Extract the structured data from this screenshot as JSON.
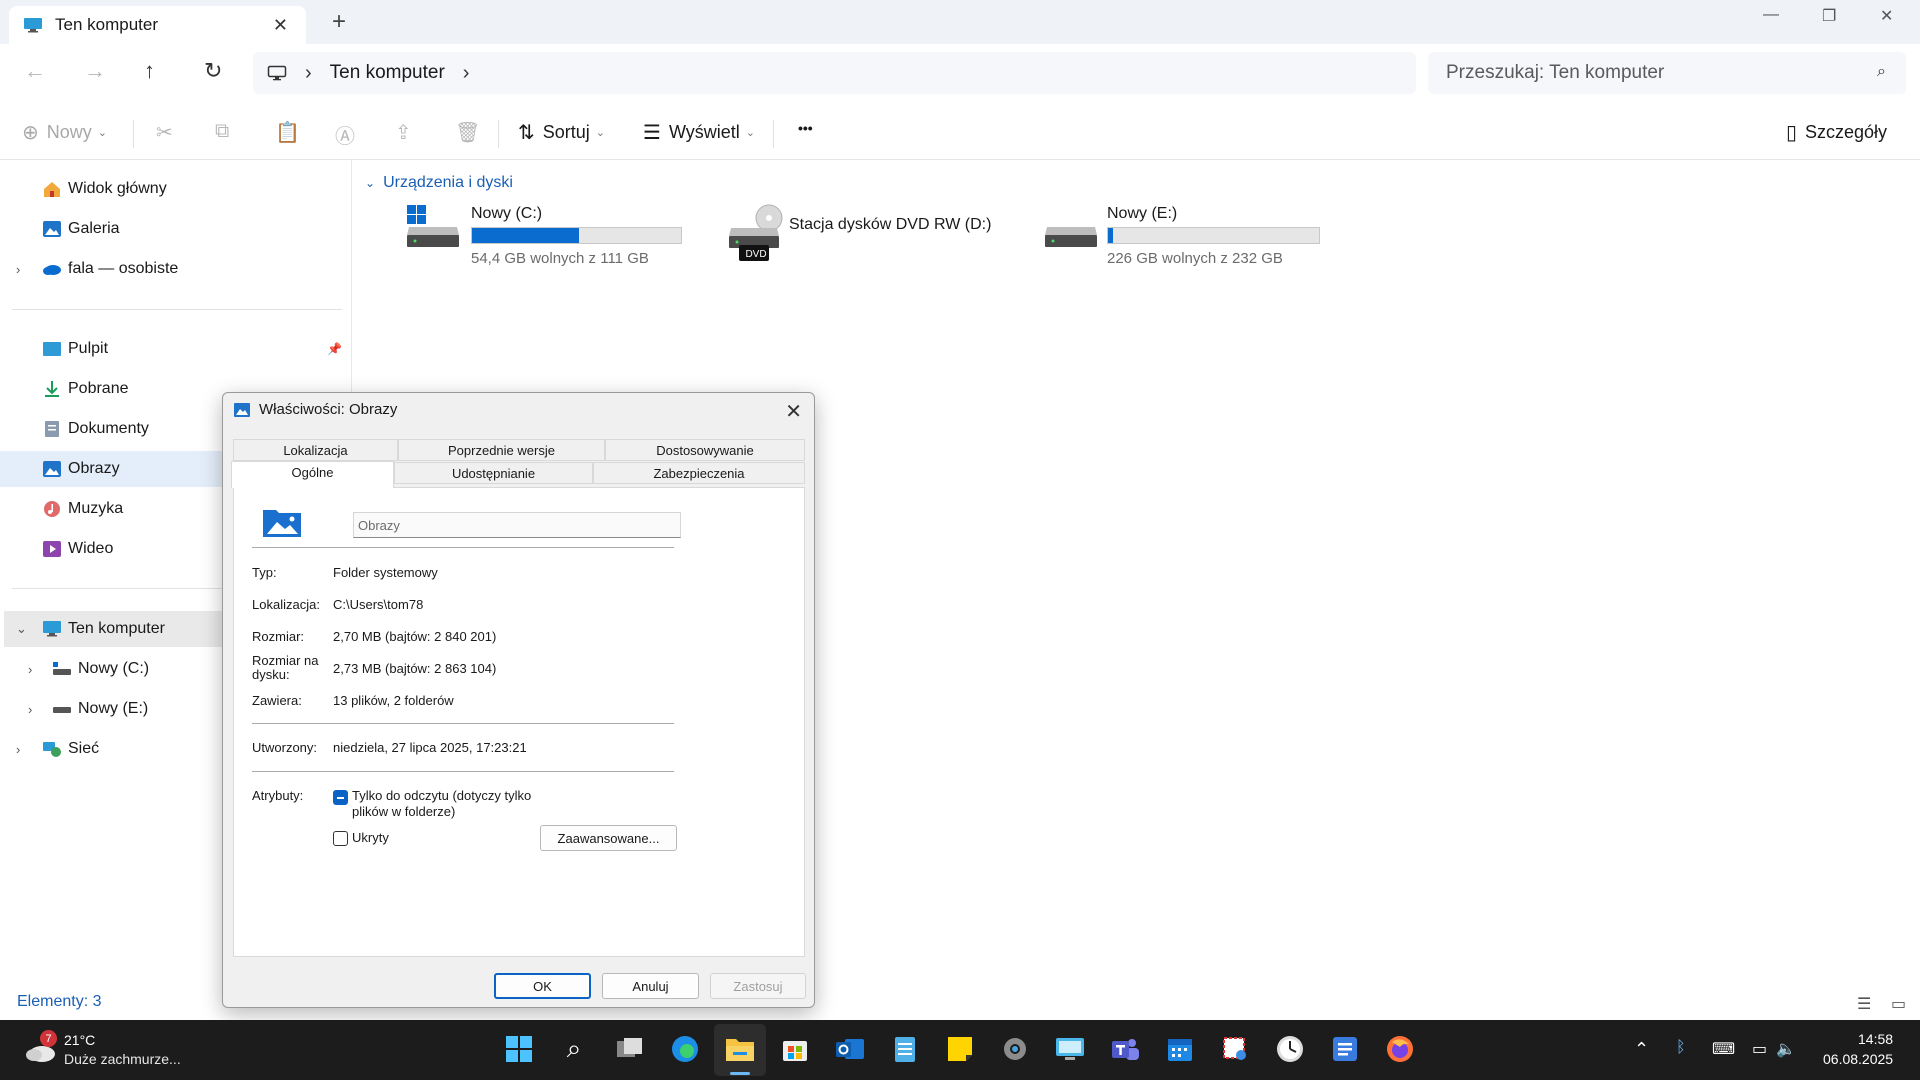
{
  "window": {
    "tab_title": "Ten komputer",
    "new_tab": "+",
    "minimize": "—",
    "maximize": "❐",
    "close": "✕"
  },
  "address": {
    "crumb": "Ten komputer",
    "search_placeholder": "Przeszukaj: Ten komputer"
  },
  "toolbar": {
    "new_label": "Nowy",
    "sort_label": "Sortuj",
    "view_label": "Wyświetl",
    "more_label": "•••",
    "details_label": "Szczegóły"
  },
  "sidebar": {
    "top": [
      {
        "label": "Widok główny",
        "icon": "home-icon"
      },
      {
        "label": "Galeria",
        "icon": "gallery-icon"
      },
      {
        "label": "fala — osobiste",
        "icon": "onedrive-icon"
      }
    ],
    "quick": [
      {
        "label": "Pulpit",
        "icon": "desktop-icon"
      },
      {
        "label": "Pobrane",
        "icon": "download-icon"
      },
      {
        "label": "Dokumenty",
        "icon": "documents-icon"
      },
      {
        "label": "Obrazy",
        "icon": "pictures-icon"
      },
      {
        "label": "Muzyka",
        "icon": "music-icon"
      },
      {
        "label": "Wideo",
        "icon": "video-icon"
      }
    ],
    "tree": [
      {
        "label": "Ten komputer",
        "icon": "computer-icon"
      },
      {
        "label": "Nowy (C:)",
        "icon": "drive-icon"
      },
      {
        "label": "Nowy (E:)",
        "icon": "drive-icon"
      },
      {
        "label": "Sieć",
        "icon": "network-icon"
      }
    ]
  },
  "main": {
    "section": "Urządzenia i dyski",
    "drives": [
      {
        "name": "Nowy (C:)",
        "free": "54,4 GB wolnych z 111 GB",
        "used_fraction": 0.51
      },
      {
        "name": "Stacja dysków DVD RW (D:)",
        "badge": "DVD"
      },
      {
        "name": "Nowy (E:)",
        "free": "226 GB wolnych z 232 GB",
        "used_fraction": 0.026
      }
    ]
  },
  "status": {
    "items": "Elementy: 3"
  },
  "dialog": {
    "title": "Właściwości: Obrazy",
    "tabs_row1": [
      "Lokalizacja",
      "Poprzednie wersje",
      "Dostosowywanie"
    ],
    "tabs_row2": [
      "Ogólne",
      "Udostępnianie",
      "Zabezpieczenia"
    ],
    "name_value": "Obrazy",
    "props": {
      "type_label": "Typ:",
      "type_value": "Folder systemowy",
      "location_label": "Lokalizacja:",
      "location_value": "C:\\Users\\tom78",
      "size_label": "Rozmiar:",
      "size_value": "2,70 MB (bajtów: 2 840 201)",
      "disk_label_1": "Rozmiar na",
      "disk_label_2": "dysku:",
      "disk_value": "2,73 MB (bajtów: 2 863 104)",
      "contains_label": "Zawiera:",
      "contains_value": "13 plików, 2 folderów",
      "created_label": "Utworzony:",
      "created_value": "niedziela, 27 lipca 2025, 17:23:21",
      "attrs_label": "Atrybuty:",
      "readonly_1": "Tylko do odczytu (dotyczy tylko",
      "readonly_2": "plików w folderze)",
      "hidden": "Ukryty",
      "advanced": "Zaawansowane..."
    },
    "buttons": {
      "ok": "OK",
      "cancel": "Anuluj",
      "apply": "Zastosuj"
    }
  },
  "taskbar": {
    "weather_badge": "7",
    "temp": "21°C",
    "desc": "Duże zachmurze...",
    "time": "14:58",
    "date": "06.08.2025"
  },
  "colors": {
    "accent": "#0a6ccf",
    "link": "#1a5fb4",
    "taskbar": "#1c1c1c"
  }
}
